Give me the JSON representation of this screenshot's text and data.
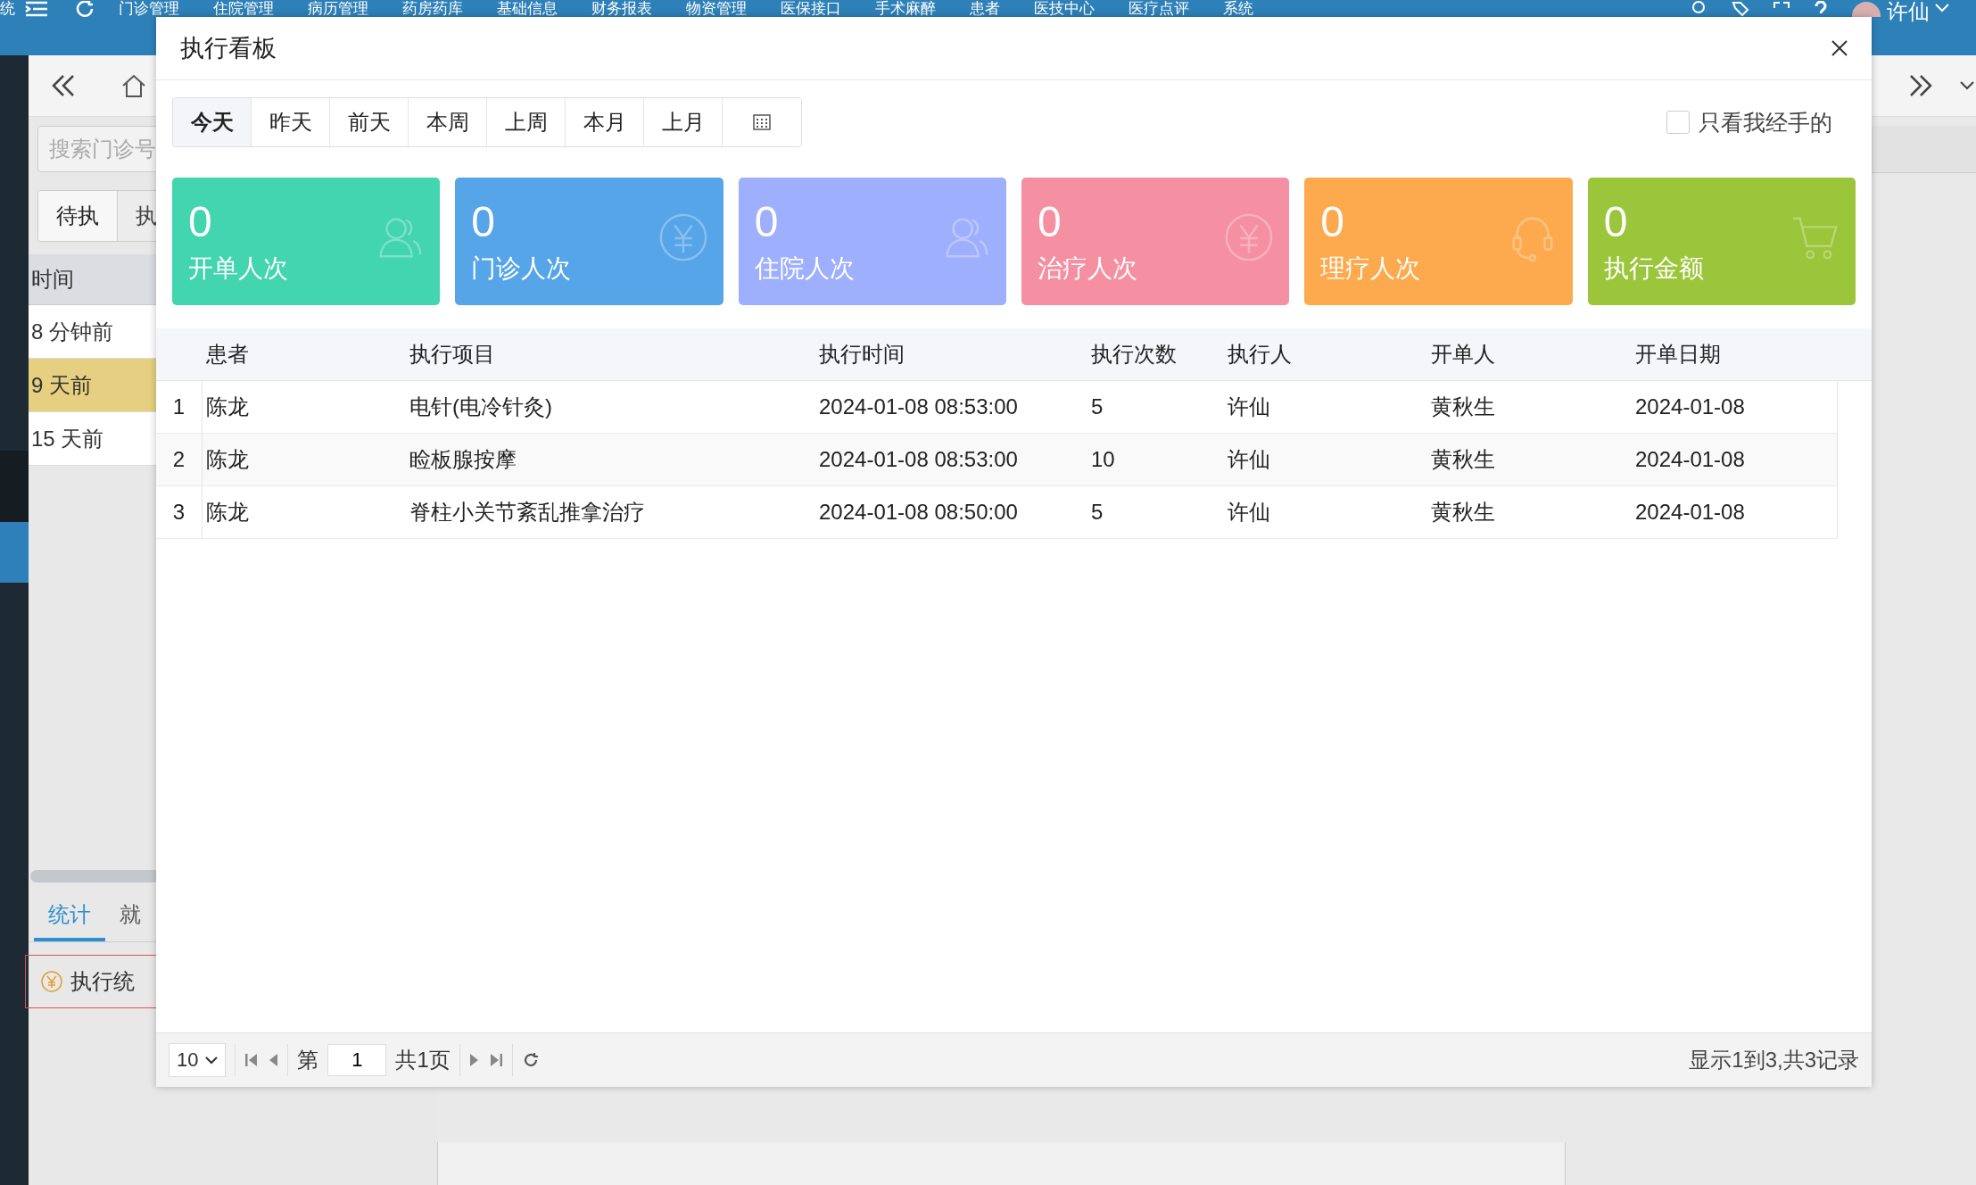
{
  "top_menu": {
    "items": [
      "统",
      "门诊管理",
      "住院管理",
      "病历管理",
      "药房药库",
      "基础信息",
      "财务报表",
      "物资管理",
      "医保接口",
      "手术麻醉",
      "患者",
      "医技中心",
      "医疗点评",
      "系统"
    ],
    "user": "许仙"
  },
  "left_panel": {
    "search": {
      "placeholder": "搜索门诊号"
    },
    "tabs": [
      {
        "label": "待执",
        "selected": true
      },
      {
        "label": "执",
        "selected": false
      }
    ],
    "column": "时间",
    "rows": [
      {
        "time": "8 分钟前",
        "selected": false
      },
      {
        "time": "9 天前",
        "selected": true
      },
      {
        "time": "15 天前",
        "selected": false
      }
    ],
    "bottom_tabs": [
      {
        "label": "统计",
        "selected": true
      },
      {
        "label": "就",
        "selected": false
      }
    ],
    "stat_item": "执行统"
  },
  "dialog": {
    "title": "执行看板",
    "date_tabs": [
      {
        "label": "今天",
        "selected": true
      },
      {
        "label": "昨天",
        "selected": false
      },
      {
        "label": "前天",
        "selected": false
      },
      {
        "label": "本周",
        "selected": false
      },
      {
        "label": "上周",
        "selected": false
      },
      {
        "label": "本月",
        "selected": false
      },
      {
        "label": "上月",
        "selected": false
      }
    ],
    "only_mine": {
      "label": "只看我经手的",
      "checked": false
    },
    "cards": [
      {
        "value": "0",
        "label": "开单人次",
        "color": "#43d4b0",
        "kind": "people"
      },
      {
        "value": "0",
        "label": "门诊人次",
        "color": "#56a5e8",
        "kind": "yen"
      },
      {
        "value": "0",
        "label": "住院人次",
        "color": "#9eaffd",
        "kind": "people"
      },
      {
        "value": "0",
        "label": "治疗人次",
        "color": "#f590a2",
        "kind": "yen"
      },
      {
        "value": "0",
        "label": "理疗人次",
        "color": "#fdaa4f",
        "kind": "headset"
      },
      {
        "value": "0",
        "label": "执行金额",
        "color": "#9bc53a",
        "kind": "cart"
      }
    ],
    "table": {
      "columns": [
        "患者",
        "执行项目",
        "执行时间",
        "执行次数",
        "执行人",
        "开单人",
        "开单日期"
      ],
      "rows": [
        {
          "index": "1",
          "cells": [
            "陈龙",
            "电针(电冷针灸)",
            "2024-01-08 08:53:00",
            "5",
            "许仙",
            "黄秋生",
            "2024-01-08"
          ]
        },
        {
          "index": "2",
          "cells": [
            "陈龙",
            "睑板腺按摩",
            "2024-01-08 08:53:00",
            "10",
            "许仙",
            "黄秋生",
            "2024-01-08"
          ]
        },
        {
          "index": "3",
          "cells": [
            "陈龙",
            "脊柱小关节紊乱推拿治疗",
            "2024-01-08 08:50:00",
            "5",
            "许仙",
            "黄秋生",
            "2024-01-08"
          ]
        }
      ]
    },
    "pager": {
      "page_size": "10",
      "page_prefix": "第",
      "page": "1",
      "total_pages": "共1页",
      "summary": "显示1到3,共3记录"
    }
  }
}
